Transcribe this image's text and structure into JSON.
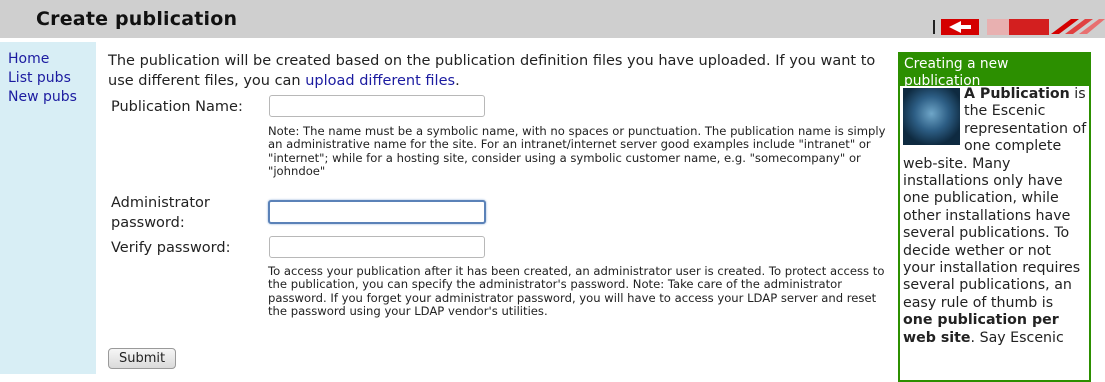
{
  "header": {
    "title": "Create publication",
    "logo_icon": "escenic-logo-icon"
  },
  "nav": {
    "items": [
      "Home",
      "List pubs",
      "New pubs"
    ]
  },
  "main": {
    "intro_text": "The publication will be created based on the publication definition files you have uploaded. If you want to use different files, you can ",
    "intro_link": "upload different files",
    "intro_end": ".",
    "pub_name_label": "Publication Name:",
    "pub_name_value": "",
    "pub_name_note": "Note: The name must be a symbolic name, with no spaces or punctuation. The publication name is simply an administrative name for the site. For an intranet/internet server good examples include \"intranet\" or \"internet\"; while for a hosting site, consider using a symbolic customer name, e.g. \"somecompany\" or \"johndoe\"",
    "admin_password_label": "Administrator password:",
    "admin_password_value": "",
    "verify_password_label": "Verify password:",
    "verify_password_value": "",
    "password_note": "To access your publication after it has been created, an administrator user is created. To protect access to the publication, you can specify the administrator's password. Note: Take care of the administrator password. If you forget your administrator password, you will have to access your LDAP server and reset the password using your LDAP vendor's utilities.",
    "submit_label": "Submit"
  },
  "sidebar": {
    "heading": "Creating a new publication",
    "term": "A Publication",
    "text_1": " is the Escenic representation of one complete web-site. Many installations only have one publication, while other installations have several publications. To decide wether or not your installation requires several publications, an easy rule of thumb is ",
    "emphasis": "one publication per web site",
    "text_2": ". Say Escenic"
  },
  "colors": {
    "header_bg": "#cfcfcf",
    "nav_bg": "#d8eef5",
    "sidebar_accent": "#2c8f00",
    "link": "#1b1ba0"
  }
}
